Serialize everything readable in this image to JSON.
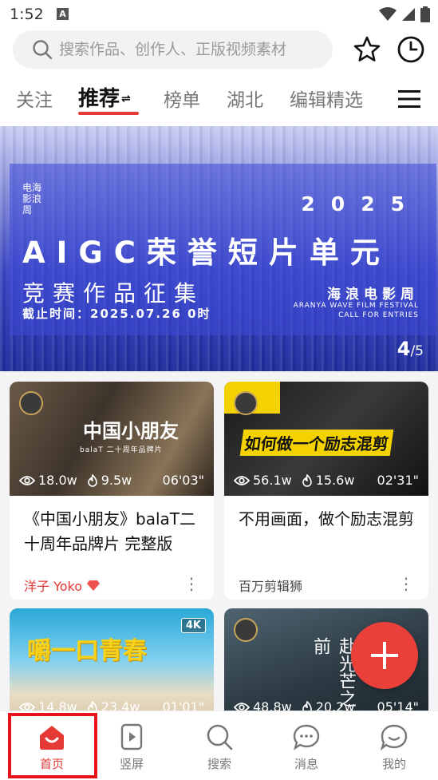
{
  "status": {
    "time": "1:52",
    "notif_letter": "A"
  },
  "search": {
    "placeholder": "搜索作品、创作人、正版视频素材"
  },
  "icons": {
    "favorites": "star-icon",
    "history": "clock-icon"
  },
  "tabs": [
    {
      "label": "关注"
    },
    {
      "label": "推荐",
      "active": true
    },
    {
      "label": "榜单"
    },
    {
      "label": "湖北"
    },
    {
      "label": "编辑精选"
    }
  ],
  "tabs_swap_glyph": "⇌",
  "banner": {
    "logo_text": "电海影浪周",
    "year": "2025",
    "title": "AIGC荣誉短片单元",
    "subtitle": "竞赛作品征集",
    "deadline": "截止时间：2025.07.26 0时",
    "fest_cn": "海浪电影周",
    "fest_en_1": "ARANYA WAVE FILM FESTIVAL",
    "fest_en_2": "CALL FOR ENTRIES",
    "page_current": "4",
    "page_total": "/5"
  },
  "cards": [
    {
      "thumb_title": "中国小朋友",
      "thumb_sub": "balaT 二十周年品牌片",
      "views": "18.0w",
      "likes": "9.5w",
      "duration": "06'03\"",
      "title": "《中国小朋友》balaT二十周年品牌片 完整版",
      "author": "洋子 Yoko"
    },
    {
      "thumb_title": "如何做一个励志混剪",
      "views": "56.1w",
      "likes": "15.6w",
      "duration": "02'31\"",
      "title": "不用画面，做个励志混剪",
      "author": "百万剪辑狮"
    },
    {
      "thumb_title": "嚼一口青春",
      "tag": "4K",
      "views": "14.8w",
      "likes": "23.4w",
      "duration": "01'01\""
    },
    {
      "thumb_title": "赴光芒之前",
      "views": "48.8w",
      "likes": "20.2w",
      "duration": "05'14\""
    }
  ],
  "nav": [
    {
      "label": "首页",
      "icon": "home-icon",
      "active": true
    },
    {
      "label": "竖屏",
      "icon": "vertical-video-icon"
    },
    {
      "label": "搜索",
      "icon": "search-icon"
    },
    {
      "label": "消息",
      "icon": "message-icon"
    },
    {
      "label": "我的",
      "icon": "profile-icon"
    }
  ],
  "colors": {
    "accent": "#e53935",
    "fab": "#e9403a",
    "highlight": "#e8121b"
  }
}
